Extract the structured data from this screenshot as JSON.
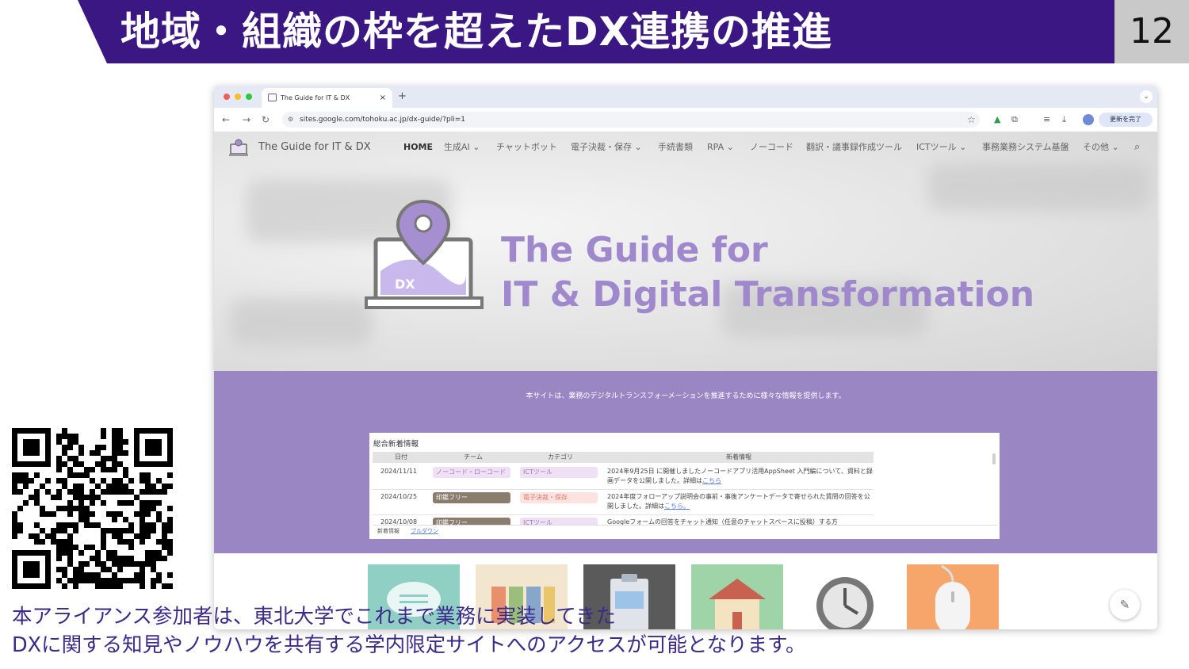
{
  "slide": {
    "title": "地域・組織の枠を超えたDX連携の推進",
    "page_number": "12",
    "caption_line1": "本アライアンス参加者は、東北大学でこれまで業務に実装してきた",
    "caption_line2": "DXに関する知見やノウハウを共有する学内限定サイトへのアクセスが可能となります。",
    "accent_color": "#3b1784"
  },
  "browser": {
    "tab_title": "The Guide for IT & DX",
    "tab_close": "×",
    "new_tab": "+",
    "url": "sites.google.com/tohoku.ac.jp/dx-guide/?pli=1",
    "update_button": "更新を完了",
    "icons": [
      "back-icon",
      "forward-icon",
      "reload-icon",
      "site-info-icon",
      "star-icon",
      "drive-icon",
      "extensions-icon",
      "tab-search-icon",
      "download-icon",
      "profile-icon",
      "menu-icon"
    ]
  },
  "site": {
    "name": "The Guide for IT & DX",
    "nav": [
      "HOME",
      "生成AI ⌄",
      "チャットボット",
      "電子決裁・保存 ⌄",
      "手続書類",
      "RPA ⌄",
      "ノーコード",
      "翻訳・議事録作成ツール",
      "ICTツール ⌄",
      "事務業務システム基盤",
      "その他 ⌄"
    ],
    "hero_line1": "The Guide for",
    "hero_line2": "IT & Digital Transformation",
    "hero_badge": "DX",
    "intro": "本サイトは、業務のデジタルトランスフォーメーションを推進するために様々な情報を提供します。",
    "news": {
      "title": "総合新着情報",
      "columns": [
        "日付",
        "チーム",
        "カテゴリ",
        "新着情報"
      ],
      "rows": [
        {
          "date": "2024/11/11",
          "team": "ノーコード・ローコード",
          "category": "ICTツール",
          "info": "2024年9月25日 に開催しましたノーコードアプリ活用AppSheet 入門編について、資料と録画データを公開しました。詳細は",
          "link": "こちら"
        },
        {
          "date": "2024/10/25",
          "team": "印鑑フリー",
          "category": "電子決裁・保存",
          "info": "2024年度フォローアップ説明会の事前・事後アンケートデータで寄せられた質問の回答を公開しました。詳細は",
          "link": "こちら。"
        },
        {
          "date": "2024/10/08",
          "team": "印鑑フリー",
          "category": "ICTツール",
          "info": "Googleフォームの回答をチャット通知（任意のチャットスペースに投稿）する方",
          "link": ""
        }
      ],
      "footer_tab1": "新着情報",
      "footer_tab2": "プルダウン"
    },
    "tile_colors": [
      "#8fcfc4",
      "#f2e6cf",
      "#5a5a5a",
      "#9fd4a8",
      "#ffffff",
      "#f6a66a"
    ]
  }
}
